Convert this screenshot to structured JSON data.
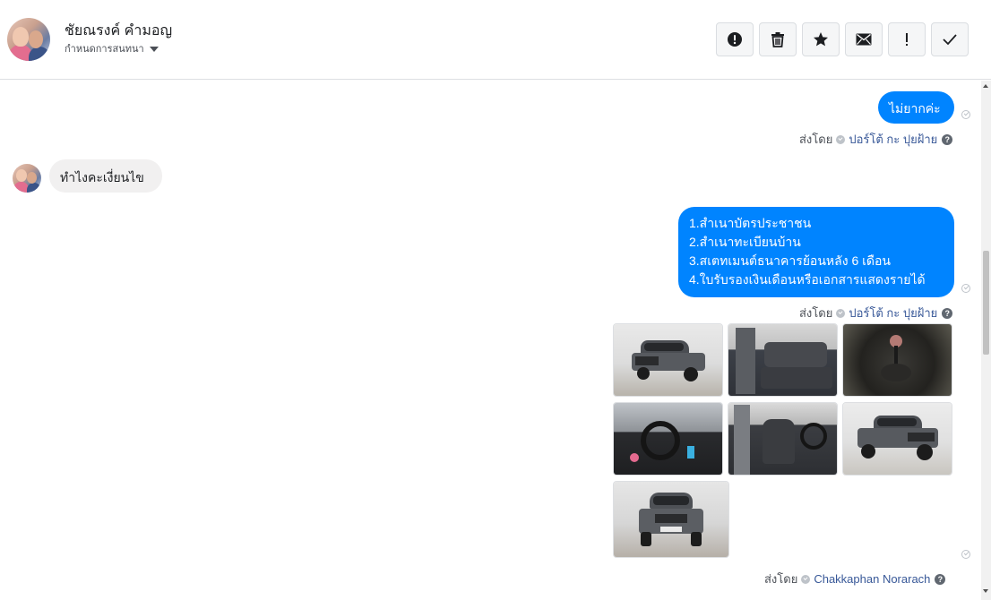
{
  "header": {
    "contact_name": "ชัยณรงค์ คำมอญ",
    "conversation_setting": "กำหนดการสนทนา"
  },
  "actions": [
    {
      "name": "report-spam-button",
      "icon": "alert-circle-icon"
    },
    {
      "name": "delete-button",
      "icon": "trash-icon"
    },
    {
      "name": "star-button",
      "icon": "star-icon"
    },
    {
      "name": "mark-unread-button",
      "icon": "envelope-icon"
    },
    {
      "name": "mark-important-button",
      "icon": "exclamation-icon"
    },
    {
      "name": "mark-done-button",
      "icon": "checkmark-icon"
    }
  ],
  "messages": {
    "out1": "ไม่ยากค่ะ",
    "sent_by_label": "ส่งโดย",
    "sender1": "ปอร์โต้ กะ ปุยฝ้าย",
    "in1": "ทำไงคะเงี่ยนไข",
    "out2_lines": [
      "1.สำเนาบัตรประชาชน",
      "2.สำเนาทะเบียนบ้าน",
      "3.สเตทเมนต์ธนาคารย้อนหลัง 6 เดือน",
      "4.ใบรับรองเงินเดือนหรือเอกสารแสดงรายได้"
    ],
    "sender2": "ปอร์โต้ กะ ปุยฝ้าย",
    "sender3": "Chakkaphan Norarach",
    "help": "?"
  },
  "photos": [
    {
      "subject": "truck-front-three-quarter"
    },
    {
      "subject": "rear-seat-interior"
    },
    {
      "subject": "gear-shifter-closeup"
    },
    {
      "subject": "dashboard-steering"
    },
    {
      "subject": "driver-seat-interior"
    },
    {
      "subject": "truck-front-three-quarter"
    },
    {
      "subject": "truck-front"
    }
  ],
  "colors": {
    "outgoing_bubble": "#0084ff",
    "incoming_bubble": "#f1f0f0",
    "sender_link": "#385898"
  }
}
